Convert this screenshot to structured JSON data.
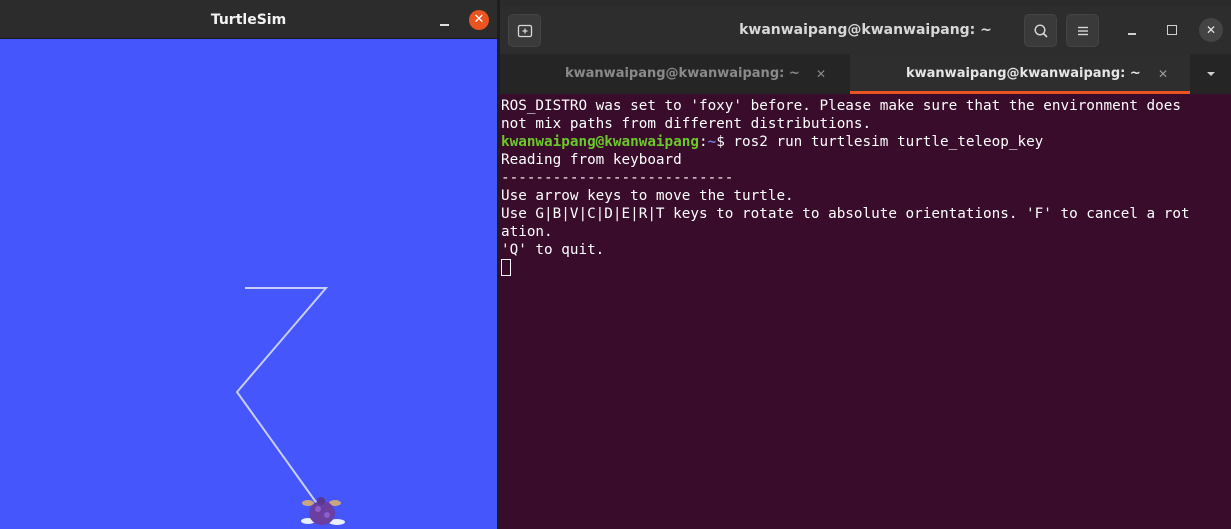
{
  "turtlesim": {
    "title": "TurtleSim",
    "close_glyph": "✕",
    "background_color": "#4556fd",
    "path_color": "#c8cef6"
  },
  "terminal": {
    "window_title": "kwanwaipang@kwanwaipang: ~",
    "close_glyph": "✕",
    "tabs": [
      {
        "label": "kwanwaipang@kwanwaipang: ~",
        "active": false,
        "close_glyph": "✕"
      },
      {
        "label": "kwanwaipang@kwanwaipang: ~",
        "active": true,
        "close_glyph": "✕"
      }
    ],
    "lines": [
      "ROS_DISTRO was set to 'foxy' before. Please make sure that the environment does",
      "not mix paths from different distributions."
    ],
    "prompt": {
      "user": "kwanwaipang@kwanwaipang",
      "separator": ":",
      "path": "~",
      "symbol": "$ ",
      "command": "ros2 run turtlesim turtle_teleop_key"
    },
    "output": [
      "Reading from keyboard",
      "---------------------------",
      "Use arrow keys to move the turtle.",
      "Use G|B|V|C|D|E|R|T keys to rotate to absolute orientations. 'F' to cancel a rot",
      "ation.",
      "'Q' to quit."
    ],
    "colors": {
      "background": "#380c2a",
      "prompt_user": "#6bc82a",
      "prompt_path": "#6e7bd8",
      "accent": "#e95420"
    }
  }
}
